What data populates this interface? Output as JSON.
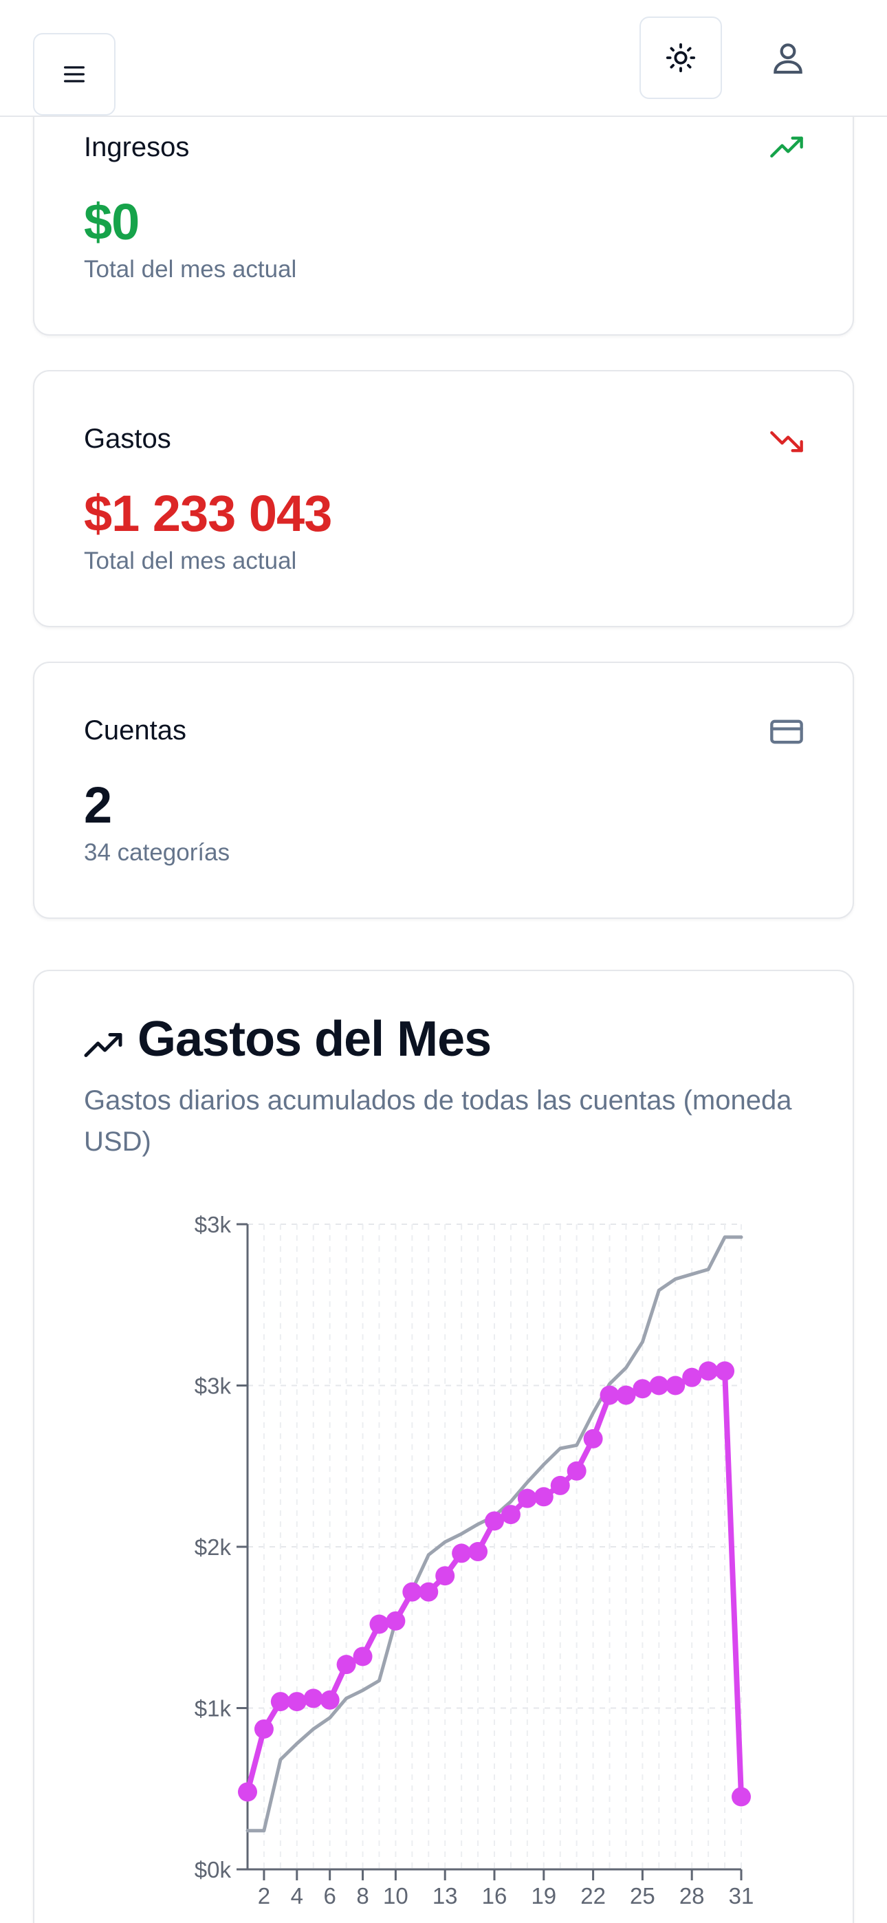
{
  "header": {
    "menu_icon": "menu-icon",
    "theme_icon": "sun-icon",
    "user_icon": "user-icon"
  },
  "cards": {
    "income": {
      "title": "Ingresos",
      "value": "$0",
      "sub": "Total del mes actual",
      "icon": "trending-up-icon",
      "color": "#16a34a"
    },
    "expenses": {
      "title": "Gastos",
      "value": "$1 233 043",
      "sub": "Total del mes actual",
      "icon": "trending-down-icon",
      "color": "#dc2626"
    },
    "accounts": {
      "title": "Cuentas",
      "value": "2",
      "sub": "34 categorías",
      "icon": "credit-card-icon",
      "color": "#0b1221"
    }
  },
  "chart_section": {
    "title": "Gastos del Mes",
    "description": "Gastos diarios acumulados de todas las cuentas (moneda USD)",
    "icon": "trending-up-icon"
  },
  "chart_data": {
    "type": "line",
    "y_tick_labels": [
      "$0k",
      "$1k",
      "$2k",
      "$3k",
      "$3k"
    ],
    "x_tick_labels": [
      "2",
      "4",
      "6",
      "8",
      "10",
      "13",
      "16",
      "19",
      "22",
      "25",
      "28",
      "31"
    ],
    "ylim": [
      0,
      4000
    ],
    "xlim": [
      1,
      31
    ],
    "grid": true,
    "series": [
      {
        "color": "#d946ef",
        "markers": true,
        "x": [
          1,
          2,
          3,
          4,
          5,
          6,
          7,
          8,
          9,
          10,
          11,
          12,
          13,
          14,
          15,
          16,
          17,
          18,
          19,
          20,
          21,
          22,
          23,
          24,
          25,
          26,
          27,
          28,
          29,
          30,
          31
        ],
        "values": [
          480,
          870,
          1040,
          1040,
          1060,
          1050,
          1270,
          1320,
          1520,
          1540,
          1720,
          1720,
          1820,
          1960,
          1970,
          2160,
          2200,
          2300,
          2310,
          2380,
          2470,
          2670,
          2940,
          2940,
          2980,
          3000,
          3000,
          3050,
          3090,
          3090,
          450
        ]
      },
      {
        "color": "#9ca3af",
        "markers": false,
        "x": [
          1,
          2,
          3,
          4,
          5,
          6,
          7,
          8,
          9,
          10,
          11,
          12,
          13,
          14,
          15,
          16,
          17,
          18,
          19,
          20,
          21,
          22,
          23,
          24,
          25,
          26,
          27,
          28,
          29,
          30,
          31
        ],
        "values": [
          240,
          240,
          680,
          780,
          870,
          940,
          1060,
          1110,
          1170,
          1540,
          1730,
          1950,
          2030,
          2080,
          2140,
          2190,
          2280,
          2400,
          2510,
          2610,
          2630,
          2830,
          3010,
          3110,
          3270,
          3590,
          3660,
          3690,
          3720,
          3920,
          3920
        ]
      }
    ]
  }
}
